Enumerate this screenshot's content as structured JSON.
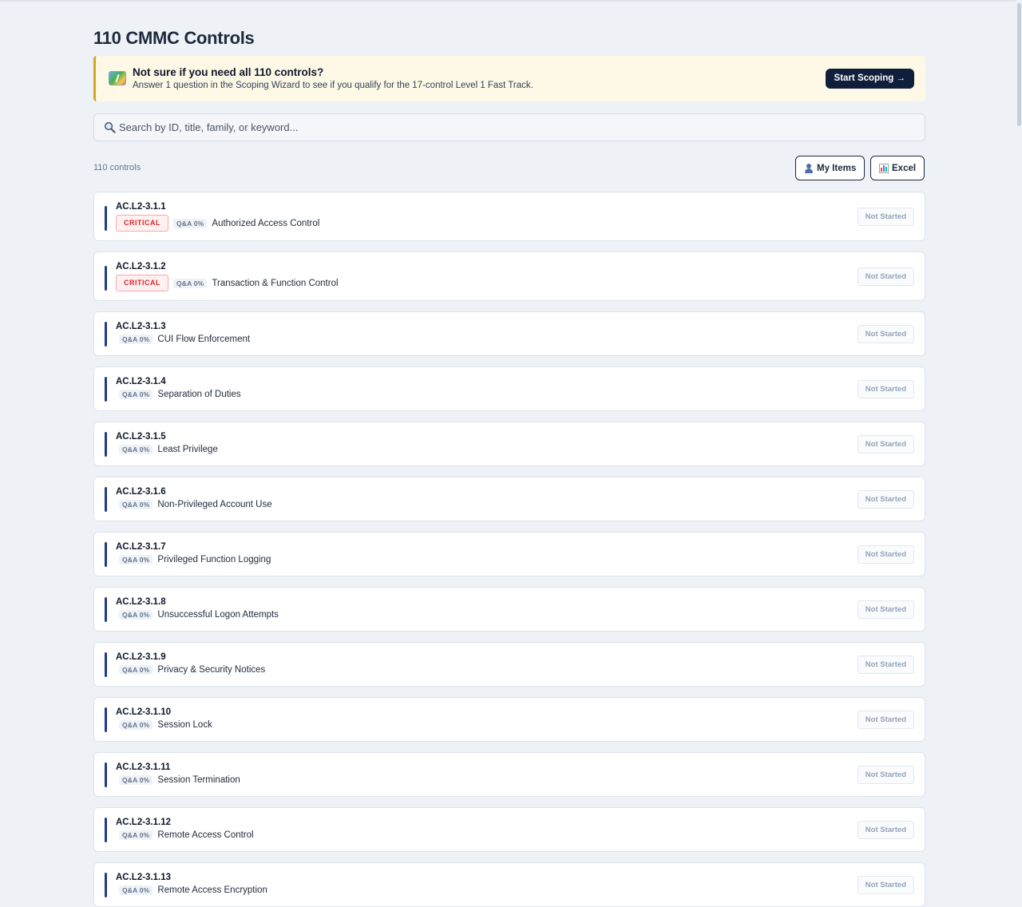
{
  "page": {
    "title": "110 CMMC Controls"
  },
  "banner": {
    "icon": "map-icon",
    "title": "Not sure if you need all 110 controls?",
    "subtitle": "Answer 1 question in the Scoping Wizard to see if you qualify for the 17-control Level 1 Fast Track.",
    "button_label": "Start Scoping →"
  },
  "search": {
    "placeholder": "Search by ID, title, family, or keyword...",
    "value": ""
  },
  "toolbar": {
    "count_label": "110 controls",
    "my_items_label": "My Items",
    "excel_label": "Excel"
  },
  "colors": {
    "accent": "#1e3a8a",
    "critical": "#dc2626",
    "banner_bg": "#fef9e6",
    "banner_border": "#d9a521"
  },
  "controls": [
    {
      "id": "AC.L2-3.1.1",
      "critical": "CRITICAL",
      "qa": "Q&A 0%",
      "title": "Authorized Access Control",
      "status": "Not Started"
    },
    {
      "id": "AC.L2-3.1.2",
      "critical": "CRITICAL",
      "qa": "Q&A 0%",
      "title": "Transaction & Function Control",
      "status": "Not Started"
    },
    {
      "id": "AC.L2-3.1.3",
      "critical": "",
      "qa": "Q&A 0%",
      "title": "CUI Flow Enforcement",
      "status": "Not Started"
    },
    {
      "id": "AC.L2-3.1.4",
      "critical": "",
      "qa": "Q&A 0%",
      "title": "Separation of Duties",
      "status": "Not Started"
    },
    {
      "id": "AC.L2-3.1.5",
      "critical": "",
      "qa": "Q&A 0%",
      "title": "Least Privilege",
      "status": "Not Started"
    },
    {
      "id": "AC.L2-3.1.6",
      "critical": "",
      "qa": "Q&A 0%",
      "title": "Non-Privileged Account Use",
      "status": "Not Started"
    },
    {
      "id": "AC.L2-3.1.7",
      "critical": "",
      "qa": "Q&A 0%",
      "title": "Privileged Function Logging",
      "status": "Not Started"
    },
    {
      "id": "AC.L2-3.1.8",
      "critical": "",
      "qa": "Q&A 0%",
      "title": "Unsuccessful Logon Attempts",
      "status": "Not Started"
    },
    {
      "id": "AC.L2-3.1.9",
      "critical": "",
      "qa": "Q&A 0%",
      "title": "Privacy & Security Notices",
      "status": "Not Started"
    },
    {
      "id": "AC.L2-3.1.10",
      "critical": "",
      "qa": "Q&A 0%",
      "title": "Session Lock",
      "status": "Not Started"
    },
    {
      "id": "AC.L2-3.1.11",
      "critical": "",
      "qa": "Q&A 0%",
      "title": "Session Termination",
      "status": "Not Started"
    },
    {
      "id": "AC.L2-3.1.12",
      "critical": "",
      "qa": "Q&A 0%",
      "title": "Remote Access Control",
      "status": "Not Started"
    },
    {
      "id": "AC.L2-3.1.13",
      "critical": "",
      "qa": "Q&A 0%",
      "title": "Remote Access Encryption",
      "status": "Not Started"
    }
  ]
}
